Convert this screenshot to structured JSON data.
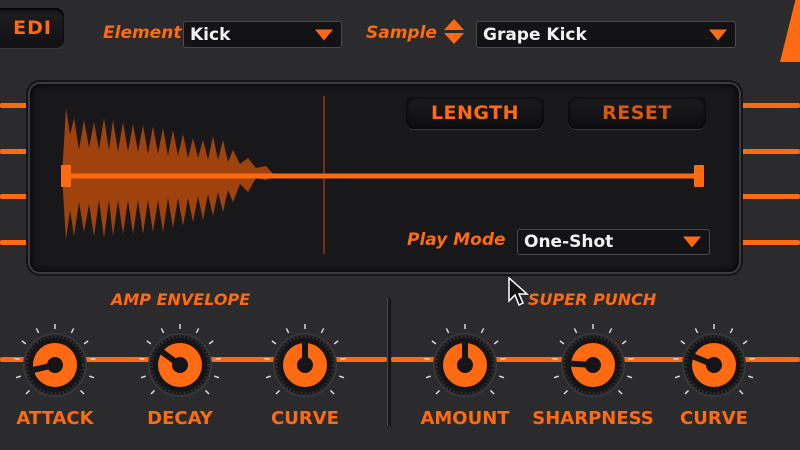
{
  "header": {
    "edit_label": "EDI",
    "element_label": "Element",
    "element_value": "Kick",
    "sample_label": "Sample",
    "sample_value": "Grape Kick"
  },
  "panel": {
    "length_label": "LENGTH",
    "reset_label": "RESET",
    "play_mode_label": "Play Mode",
    "play_mode_value": "One-Shot"
  },
  "amp_envelope": {
    "title": "AMP ENVELOPE",
    "knobs": [
      {
        "label": "ATTACK",
        "value": 0.12
      },
      {
        "label": "DECAY",
        "value": 0.3
      },
      {
        "label": "CURVE",
        "value": 0.5
      }
    ]
  },
  "super_punch": {
    "title": "SUPER PUNCH",
    "knobs": [
      {
        "label": "AMOUNT",
        "value": 0.5
      },
      {
        "label": "SHARPNESS",
        "value": 0.18
      },
      {
        "label": "CURVE",
        "value": 0.25
      }
    ]
  },
  "colors": {
    "accent": "#ff6a12",
    "accent_dim": "#b84a0c",
    "background": "#2b2b2d",
    "panel_bg": "#18181a",
    "text_light": "#f2f2f2"
  },
  "icons": {
    "cursor": "mouse-pointer-icon",
    "dropdown": "chevron-down-icon",
    "stepper": "up-down-arrows-icon"
  }
}
